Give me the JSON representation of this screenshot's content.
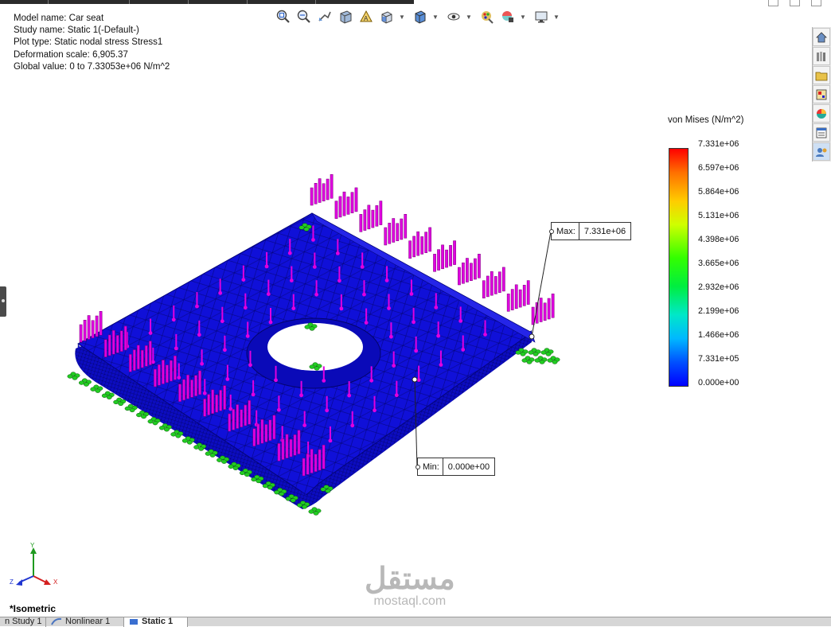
{
  "info": {
    "model_name": "Model name: Car seat",
    "study_name": "Study name: Static 1(-Default-)",
    "plot_type": "Plot type: Static nodal stress Stress1",
    "deformation_scale": "Deformation scale: 6,905.37",
    "global_value": "Global value: 0 to 7.33053e+06 N/m^2"
  },
  "hud_icons": [
    "zoom-to-fit-icon",
    "zoom-to-area-icon",
    "previous-view-icon",
    "section-view-icon",
    "dynamic-annotation-views-icon",
    "view-orientation-icon",
    "display-style-icon",
    "hide-show-items-icon",
    "edit-appearance-icon",
    "apply-scene-icon",
    "view-settings-icon"
  ],
  "taskpane_icons": [
    "home-icon",
    "design-library-icon",
    "file-explorer-icon",
    "view-palette-icon",
    "appearances-icon",
    "custom-properties-icon",
    "simulation-advisor-icon"
  ],
  "legend": {
    "title": "von Mises (N/m^2)",
    "ticks": [
      "7.331e+06",
      "6.597e+06",
      "5.864e+06",
      "5.131e+06",
      "4.398e+06",
      "3.665e+06",
      "2.932e+06",
      "2.199e+06",
      "1.466e+06",
      "7.331e+05",
      "0.000e+00"
    ],
    "colors": {
      "max": "#ff0000",
      "mid": "#33ff00",
      "min": "#0000ff"
    }
  },
  "max_callout": {
    "label": "Max:",
    "value": "7.331e+06"
  },
  "min_callout": {
    "label": "Min:",
    "value": "0.000e+00"
  },
  "triad": {
    "y": "Y",
    "z": "Z",
    "x": "X"
  },
  "view_name": "*Isometric",
  "tabs": [
    {
      "label": "n Study 1",
      "active": false
    },
    {
      "label": "Nonlinear 1",
      "active": false
    },
    {
      "label": "Static 1",
      "active": true
    }
  ],
  "watermark": {
    "arabic": "مستقل",
    "latin": "mostaql.com"
  },
  "colors": {
    "mesh": "#1010d8",
    "loads": "#e000e0",
    "fixtures": "#22cc22"
  }
}
